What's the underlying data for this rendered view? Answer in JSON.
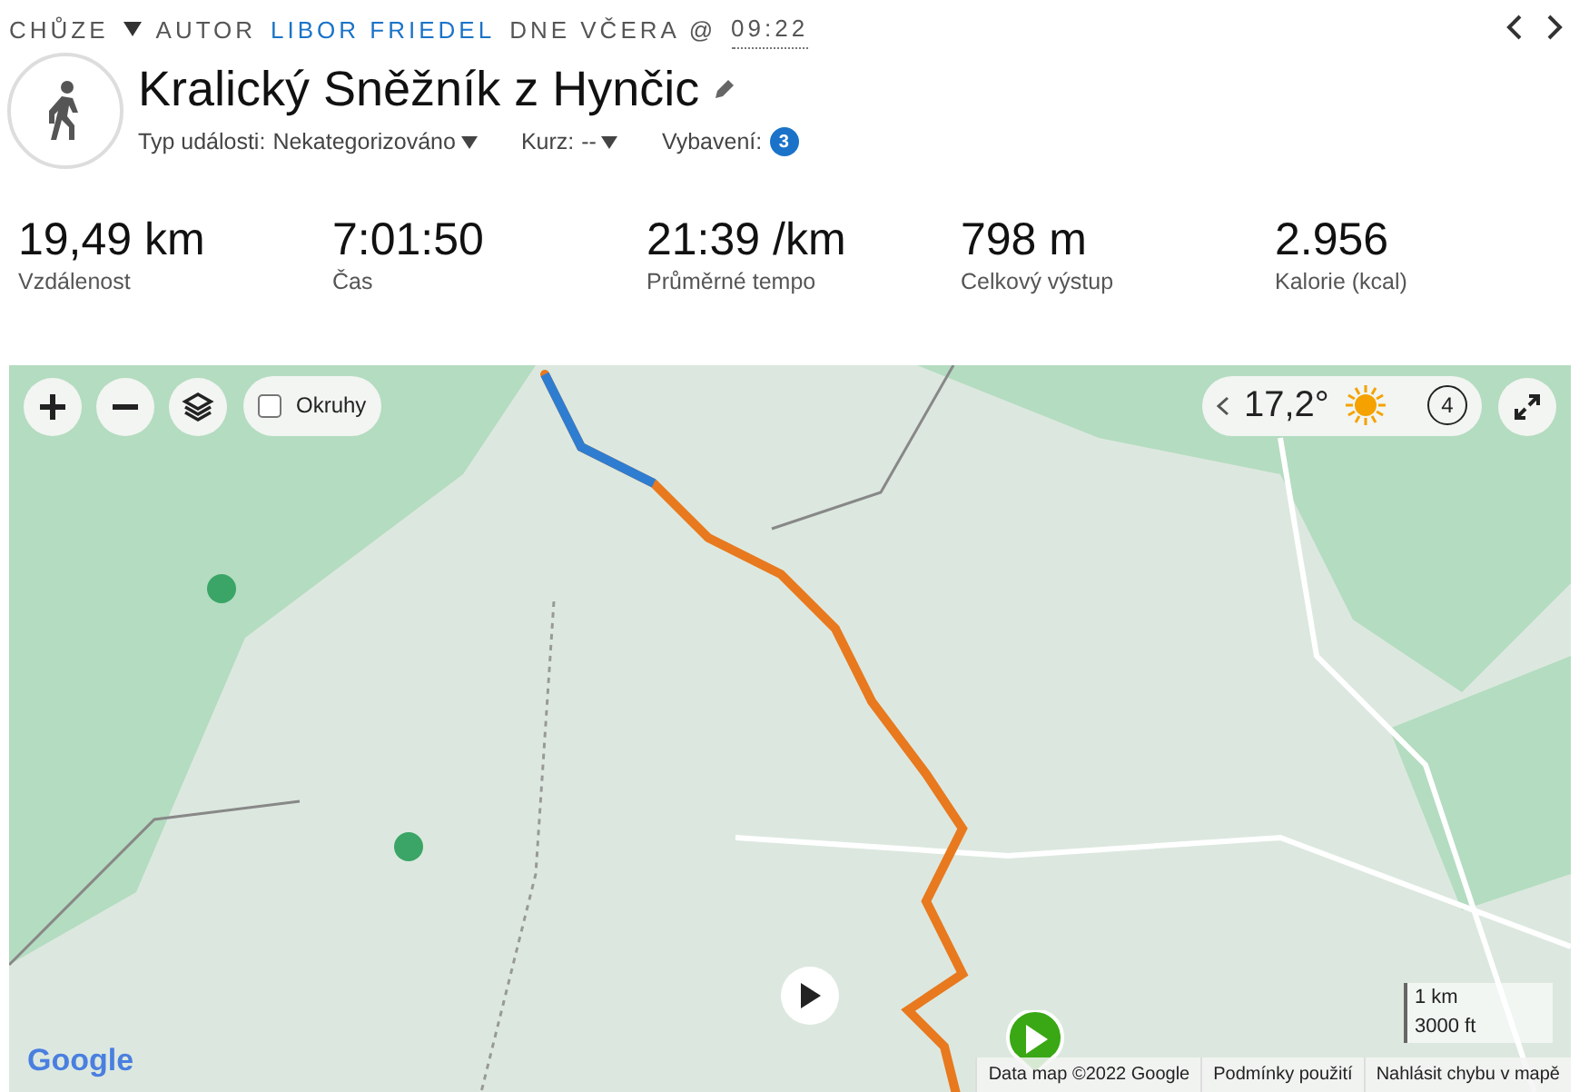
{
  "header": {
    "activity_type": "CHŮZE",
    "author_prefix": "AUTOR",
    "author": "LIBOR FRIEDEL",
    "date_text": "DNE VČERA @",
    "time": "09:22"
  },
  "title": "Kralický Sněžník z Hynčic",
  "meta": [
    {
      "kind": "dropdown",
      "label": "Typ události:",
      "value": "Nekategorizováno"
    },
    {
      "kind": "dropdown",
      "label": "Kurz:",
      "value": "--"
    },
    {
      "kind": "badge",
      "label": "Vybavení:",
      "value": "3"
    }
  ],
  "stats": [
    {
      "value": "19,49 km",
      "label": "Vzdálenost"
    },
    {
      "value": "7:01:50",
      "label": "Čas"
    },
    {
      "value": "21:39 /km",
      "label": "Průměrné tempo"
    },
    {
      "value": "798 m",
      "label": "Celkový výstup"
    },
    {
      "value": "2.956",
      "label": "Kalorie (kcal)"
    }
  ],
  "map": {
    "laps": {
      "label": "Okruhy",
      "checked": false
    },
    "temperature": "17,2°",
    "weather_count": "4",
    "scale": [
      "1 km",
      "3000 ft"
    ],
    "logo": "Google",
    "footer_links": [
      "Data map ©2022 Google",
      "Podmínky použití",
      "Nahlásit chybu v mapě"
    ]
  }
}
